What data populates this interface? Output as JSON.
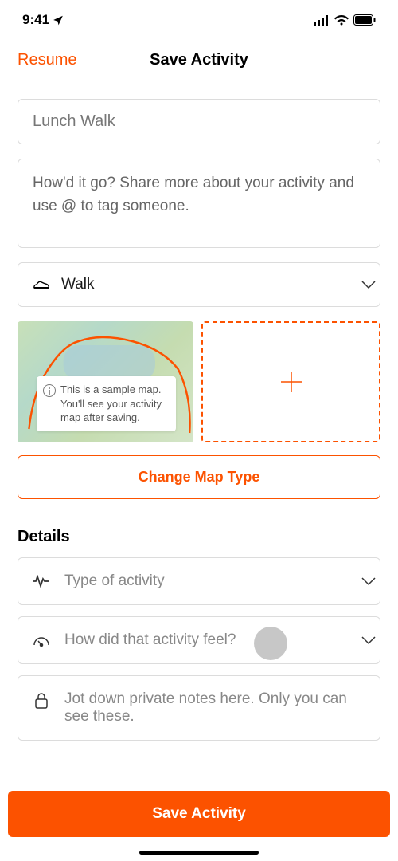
{
  "status": {
    "time": "9:41"
  },
  "header": {
    "left_action": "Resume",
    "title": "Save Activity"
  },
  "fields": {
    "title_placeholder": "Lunch Walk",
    "description_placeholder": "How'd it go? Share more about your activity and use @ to tag someone.",
    "activity_type_selected": "Walk"
  },
  "map": {
    "note_text": "This is a sample map. You'll see your activity map after saving.",
    "change_map_type": "Change Map Type"
  },
  "details": {
    "heading": "Details",
    "type_placeholder": "Type of activity",
    "effort_placeholder": "How did that activity feel?",
    "notes_placeholder": "Jot down private notes here. Only you can see these."
  },
  "actions": {
    "save": "Save Activity"
  },
  "colors": {
    "accent": "#fc5200"
  }
}
